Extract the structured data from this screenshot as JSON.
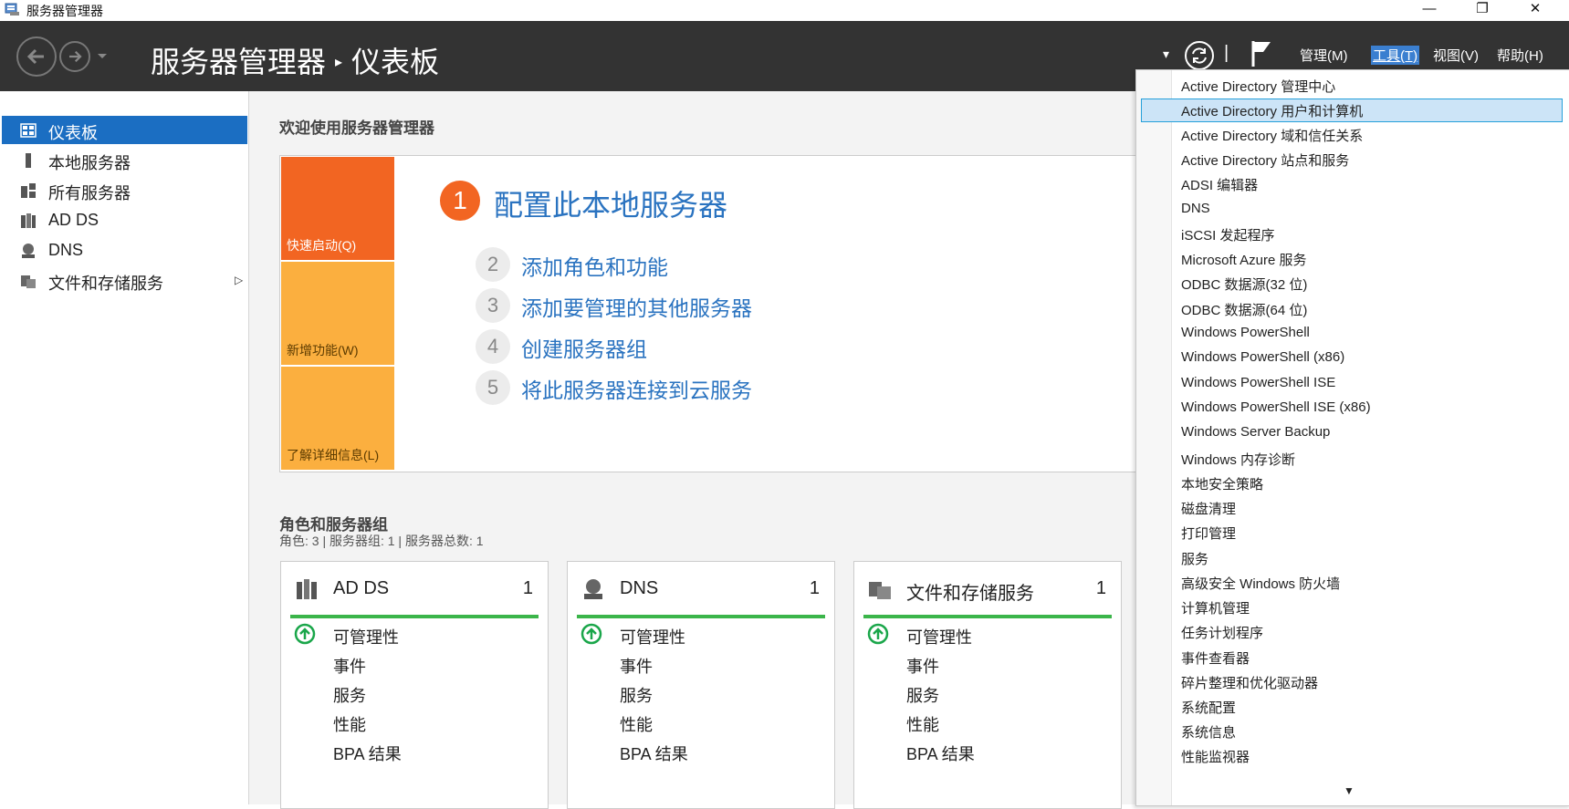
{
  "window": {
    "title": "服务器管理器",
    "minimize_glyph": "—",
    "restore_glyph": "❐",
    "close_glyph": "✕"
  },
  "header": {
    "app_name": "服务器管理器",
    "separator": "▸",
    "page": "仪表板",
    "dropdown_glyph": "▾",
    "divider": "|",
    "menus": [
      {
        "label": "管理(M)"
      },
      {
        "label": "工具(T)"
      },
      {
        "label": "视图(V)"
      },
      {
        "label": "帮助(H)"
      }
    ]
  },
  "sidebar": {
    "items": [
      {
        "label": "仪表板",
        "selected": true
      },
      {
        "label": "本地服务器"
      },
      {
        "label": "所有服务器"
      },
      {
        "label": "AD DS"
      },
      {
        "label": "DNS"
      },
      {
        "label": "文件和存储服务",
        "has_submenu": true,
        "arrow": "▷"
      }
    ]
  },
  "main": {
    "welcome": "欢迎使用服务器管理器",
    "tiles": [
      {
        "label": "快速启动(Q)",
        "color": "#f26522"
      },
      {
        "label": "新增功能(W)",
        "color": "#fbaf3f"
      },
      {
        "label": "了解详细信息(L)",
        "color": "#fbaf3f"
      }
    ],
    "steps": [
      {
        "num": "1",
        "label": "配置此本地服务器"
      },
      {
        "num": "2",
        "label": "添加角色和功能"
      },
      {
        "num": "3",
        "label": "添加要管理的其他服务器"
      },
      {
        "num": "4",
        "label": "创建服务器组"
      },
      {
        "num": "5",
        "label": "将此服务器连接到云服务"
      }
    ],
    "roles_title": "角色和服务器组",
    "roles_summary": "角色: 3 | 服务器组: 1 | 服务器总数: 1",
    "cards": [
      {
        "title": "AD DS",
        "count": "1",
        "rows": [
          "可管理性",
          "事件",
          "服务",
          "性能",
          "BPA 结果"
        ]
      },
      {
        "title": "DNS",
        "count": "1",
        "rows": [
          "可管理性",
          "事件",
          "服务",
          "性能",
          "BPA 结果"
        ]
      },
      {
        "title": "文件和存储服务",
        "count": "1",
        "rows": [
          "可管理性",
          "事件",
          "服务",
          "性能",
          "BPA 结果"
        ]
      }
    ]
  },
  "tools_menu": {
    "highlighted_index": 1,
    "scroll_glyph": "▼",
    "items": [
      "Active Directory 管理中心",
      "Active Directory 用户和计算机",
      "Active Directory 域和信任关系",
      "Active Directory 站点和服务",
      "ADSI 编辑器",
      "DNS",
      "iSCSI 发起程序",
      "Microsoft Azure 服务",
      "ODBC 数据源(32 位)",
      "ODBC 数据源(64 位)",
      "Windows PowerShell",
      "Windows PowerShell (x86)",
      "Windows PowerShell ISE",
      "Windows PowerShell ISE (x86)",
      "Windows Server Backup",
      "Windows 内存诊断",
      "本地安全策略",
      "磁盘清理",
      "打印管理",
      "服务",
      "高级安全 Windows 防火墙",
      "计算机管理",
      "任务计划程序",
      "事件查看器",
      "碎片整理和优化驱动器",
      "系统配置",
      "系统信息",
      "性能监视器"
    ]
  },
  "colors": {
    "header_bg": "#333333",
    "accent_blue": "#1b6ec2",
    "link_blue": "#2a73c0",
    "quickstart_orange": "#f26522",
    "tile_amber": "#fbaf3f",
    "status_green": "#3bb54a"
  }
}
